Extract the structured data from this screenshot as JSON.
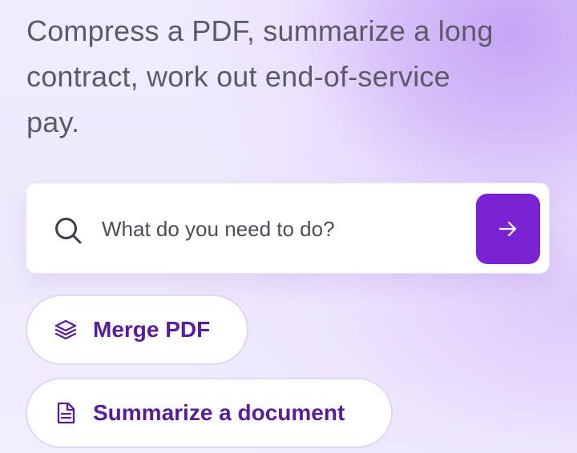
{
  "headline": "Compress a PDF, summarize a long contract, work out end-of-service pay.",
  "search": {
    "placeholder": "What do you need to do?",
    "icon": "search-icon",
    "submit_icon": "arrow-right-icon"
  },
  "suggestions": [
    {
      "label": "Merge PDF",
      "icon": "layers-icon"
    },
    {
      "label": "Summarize a document",
      "icon": "document-icon"
    }
  ],
  "colors": {
    "accent": "#7b22d2",
    "chip_text": "#5a1b9c",
    "headline_text": "#5d5a66"
  }
}
